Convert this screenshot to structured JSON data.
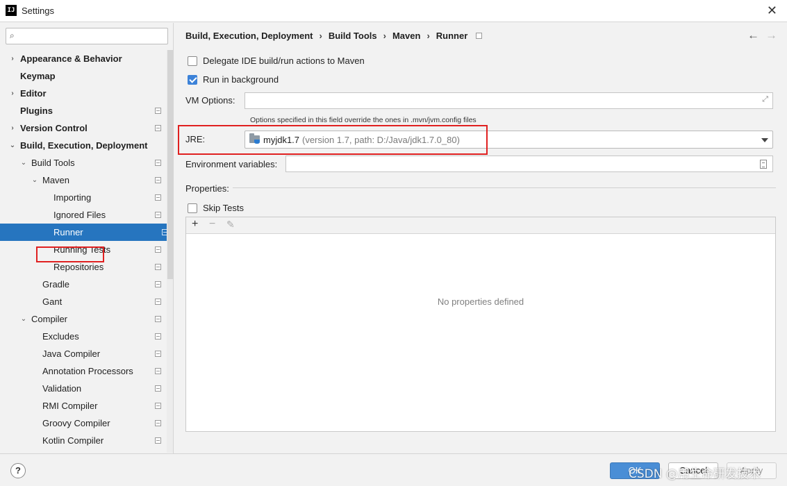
{
  "window": {
    "title": "Settings",
    "app_icon_text": "IJ",
    "close_icon": "close-icon"
  },
  "search": {
    "placeholder": "",
    "value": "",
    "icon": "search-icon"
  },
  "sidebar": {
    "items": [
      {
        "label": "Appearance & Behavior",
        "arrow": "›",
        "bold": true
      },
      {
        "label": "Keymap",
        "arrow": "",
        "bold": true
      },
      {
        "label": "Editor",
        "arrow": "›",
        "bold": true
      },
      {
        "label": "Plugins",
        "arrow": "",
        "bold": true
      },
      {
        "label": "Version Control",
        "arrow": "›",
        "bold": true
      },
      {
        "label": "Build, Execution, Deployment",
        "arrow": "⌄",
        "bold": true
      },
      {
        "label": "Build Tools",
        "arrow": "⌄",
        "bold": false
      },
      {
        "label": "Maven",
        "arrow": "⌄",
        "bold": false
      },
      {
        "label": "Importing",
        "arrow": "",
        "bold": false
      },
      {
        "label": "Ignored Files",
        "arrow": "",
        "bold": false
      },
      {
        "label": "Runner",
        "arrow": "",
        "bold": false,
        "selected": true
      },
      {
        "label": "Running Tests",
        "arrow": "",
        "bold": false
      },
      {
        "label": "Repositories",
        "arrow": "",
        "bold": false
      },
      {
        "label": "Gradle",
        "arrow": "",
        "bold": false
      },
      {
        "label": "Gant",
        "arrow": "",
        "bold": false
      },
      {
        "label": "Compiler",
        "arrow": "⌄",
        "bold": false
      },
      {
        "label": "Excludes",
        "arrow": "",
        "bold": false
      },
      {
        "label": "Java Compiler",
        "arrow": "",
        "bold": false
      },
      {
        "label": "Annotation Processors",
        "arrow": "",
        "bold": false
      },
      {
        "label": "Validation",
        "arrow": "",
        "bold": false
      },
      {
        "label": "RMI Compiler",
        "arrow": "",
        "bold": false
      },
      {
        "label": "Groovy Compiler",
        "arrow": "",
        "bold": false
      },
      {
        "label": "Kotlin Compiler",
        "arrow": "",
        "bold": false
      }
    ]
  },
  "breadcrumb": [
    "Build, Execution, Deployment",
    "Build Tools",
    "Maven",
    "Runner"
  ],
  "breadcrumb_separator": "›",
  "nav": {
    "back": "←",
    "forward": "→"
  },
  "runner": {
    "delegate_label": "Delegate IDE build/run actions to Maven",
    "delegate_checked": false,
    "background_label": "Run in background",
    "background_checked": true,
    "vm_options_label": "VM Options:",
    "vm_options_value": "",
    "vm_options_hint": "Options specified in this field override the ones in .mvn/jvm.config files",
    "jre_label": "JRE:",
    "jre_name": "myjdk1.7",
    "jre_detail": "(version 1.7, path: D:/Java/jdk1.7.0_80)",
    "env_label": "Environment variables:",
    "env_value": "",
    "properties_label": "Properties:",
    "skip_tests_label": "Skip Tests",
    "skip_tests_checked": false,
    "toolbar": {
      "add": "+",
      "remove": "−",
      "edit": "✎"
    },
    "empty_text": "No properties defined"
  },
  "footer": {
    "help": "?",
    "ok": "OK",
    "cancel": "Cancel",
    "apply": "Apply"
  },
  "watermark": "CSDN @用生命研发技术",
  "colors": {
    "selection": "#2675bf",
    "highlight_box": "#e02020",
    "ok_button": "#4a8ed6"
  }
}
